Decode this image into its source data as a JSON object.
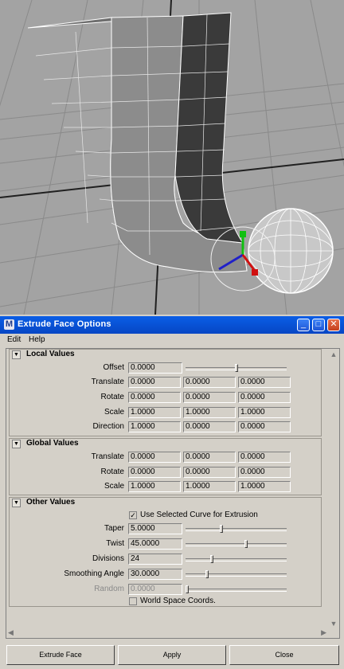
{
  "window": {
    "title": "Extrude Face Options",
    "app_icon": "M",
    "controls": {
      "minimize": "_",
      "maximize": "□",
      "close": "✕"
    }
  },
  "menu": [
    "Edit",
    "Help"
  ],
  "sections": {
    "local": {
      "title": "Local Values",
      "offset": {
        "label": "Offset",
        "value": "0.0000",
        "slider": 0.5
      },
      "translate": {
        "label": "Translate",
        "values": [
          "0.0000",
          "0.0000",
          "0.0000"
        ]
      },
      "rotate": {
        "label": "Rotate",
        "values": [
          "0.0000",
          "0.0000",
          "0.0000"
        ]
      },
      "scale": {
        "label": "Scale",
        "values": [
          "1.0000",
          "1.0000",
          "1.0000"
        ]
      },
      "direction": {
        "label": "Direction",
        "values": [
          "1.0000",
          "0.0000",
          "0.0000"
        ]
      }
    },
    "global": {
      "title": "Global Values",
      "translate": {
        "label": "Translate",
        "values": [
          "0.0000",
          "0.0000",
          "0.0000"
        ]
      },
      "rotate": {
        "label": "Rotate",
        "values": [
          "0.0000",
          "0.0000",
          "0.0000"
        ]
      },
      "scale": {
        "label": "Scale",
        "values": [
          "1.0000",
          "1.0000",
          "1.0000"
        ]
      }
    },
    "other": {
      "title": "Other Values",
      "use_curve": {
        "label": "Use Selected Curve for Extrusion",
        "checked": true
      },
      "taper": {
        "label": "Taper",
        "value": "5.0000",
        "slider": 0.35
      },
      "twist": {
        "label": "Twist",
        "value": "45.0000",
        "slider": 0.6
      },
      "divisions": {
        "label": "Divisions",
        "value": "24",
        "slider": 0.25
      },
      "smoothing_angle": {
        "label": "Smoothing Angle",
        "value": "30.0000",
        "slider": 0.2
      },
      "random": {
        "label": "Random",
        "value": "0.0000",
        "slider": 0.0
      },
      "world_space": {
        "label": "World Space Coords.",
        "checked": false
      }
    }
  },
  "buttons": {
    "extrude": "Extrude Face",
    "apply": "Apply",
    "close": "Close"
  },
  "colors": {
    "titlebar": "#0a5ee6",
    "viewport": "#a3a3a3",
    "dialog": "#d4d0c8"
  }
}
